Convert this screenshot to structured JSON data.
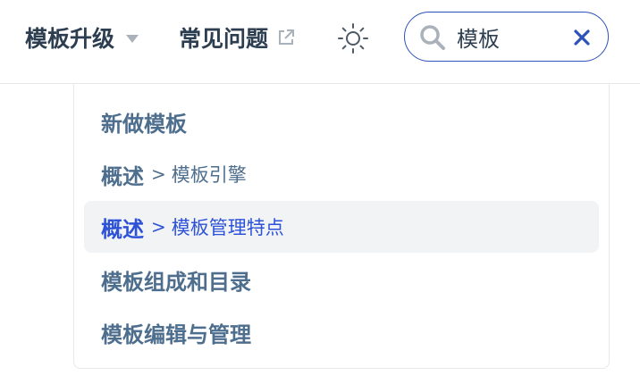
{
  "navbar": {
    "upgrade_label": "模板升级",
    "faq_label": "常见问题"
  },
  "search": {
    "value": "模板"
  },
  "suggestions": [
    {
      "title": "新做模板",
      "separator": "",
      "subtitle": ""
    },
    {
      "title": "概述",
      "separator": ">",
      "subtitle": "模板引擎"
    },
    {
      "title": "概述",
      "separator": ">",
      "subtitle": "模板管理特点"
    },
    {
      "title": "模板组成和目录",
      "separator": "",
      "subtitle": ""
    },
    {
      "title": "模板编辑与管理",
      "separator": "",
      "subtitle": ""
    }
  ],
  "icons": {
    "caret": "chevron-down-icon",
    "external": "external-link-icon",
    "theme": "sun-icon",
    "search": "search-icon",
    "clear": "close-icon"
  },
  "colors": {
    "text": "#2c3e50",
    "suggestion_text": "#4e6e8e",
    "accent": "#2d52d8",
    "active_bg": "#f1f3f5",
    "border": "#e6e8eb"
  }
}
